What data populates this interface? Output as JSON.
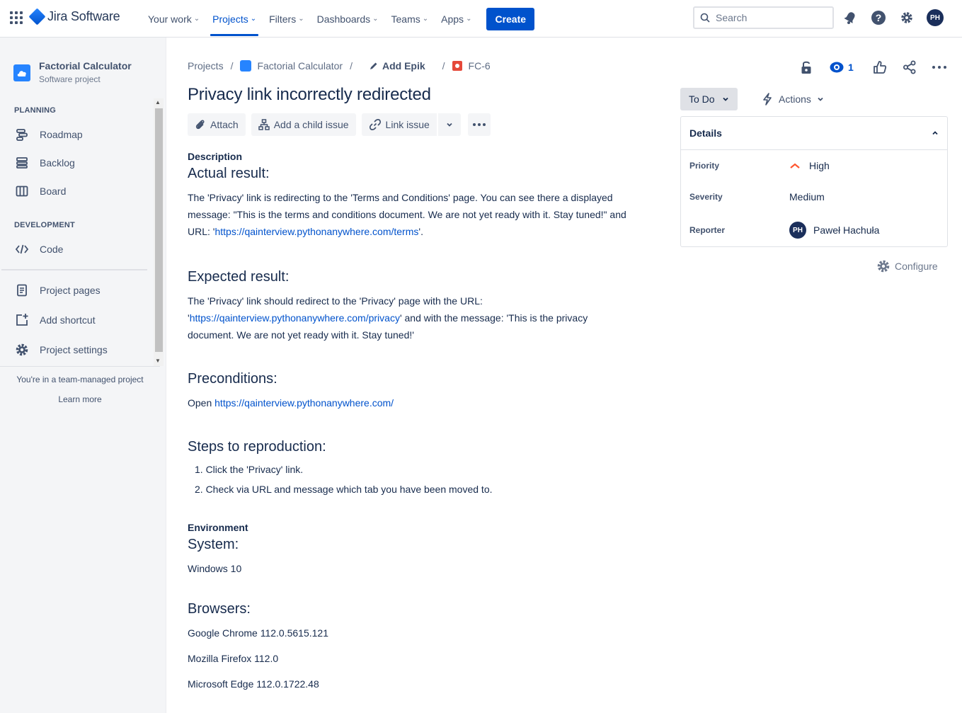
{
  "topnav": {
    "logo_text": "Jira Software",
    "items": [
      {
        "label": "Your work"
      },
      {
        "label": "Projects"
      },
      {
        "label": "Filters"
      },
      {
        "label": "Dashboards"
      },
      {
        "label": "Teams"
      },
      {
        "label": "Apps"
      }
    ],
    "create_label": "Create",
    "search_placeholder": "Search",
    "avatar_initials": "PH"
  },
  "sidebar": {
    "project_name": "Factorial Calculator",
    "project_type": "Software project",
    "planning_title": "PLANNING",
    "planning_items": [
      {
        "label": "Roadmap",
        "icon": "roadmap-icon"
      },
      {
        "label": "Backlog",
        "icon": "backlog-icon"
      },
      {
        "label": "Board",
        "icon": "board-icon"
      }
    ],
    "development_title": "DEVELOPMENT",
    "development_items": [
      {
        "label": "Code",
        "icon": "code-icon"
      }
    ],
    "other_items": [
      {
        "label": "Project pages",
        "icon": "pages-icon"
      },
      {
        "label": "Add shortcut",
        "icon": "add-shortcut-icon"
      },
      {
        "label": "Project settings",
        "icon": "gear-icon"
      }
    ],
    "team_note": "You're in a team-managed project",
    "learn_more": "Learn more"
  },
  "breadcrumb": {
    "projects": "Projects",
    "project": "Factorial Calculator",
    "add_epic": "Add Epik",
    "issue_key": "FC-6"
  },
  "issue": {
    "title": "Privacy link incorrectly redirected",
    "toolbar": {
      "attach": "Attach",
      "add_child": "Add a child issue",
      "link_issue": "Link issue"
    },
    "description_label": "Description",
    "actual_heading": "Actual result:",
    "actual_text_1": "The 'Privacy' link is redirecting to the 'Terms and Conditions' page. You can see there a displayed message: \"This is the terms and conditions document. We are not yet ready with it. Stay tuned!\" and URL: '",
    "actual_link": "https://qainterview.pythonanywhere.com/terms",
    "actual_text_2": "'.",
    "expected_heading": "Expected result:",
    "expected_text_1": "The 'Privacy' link should redirect to the 'Privacy' page with the URL: '",
    "expected_link": "https://qainterview.pythonanywhere.com/privacy",
    "expected_text_2": "' and with the message: 'This is the privacy document. We are not yet ready with it. Stay tuned!'",
    "preconditions_heading": "Preconditions:",
    "preconditions_prefix": "Open ",
    "preconditions_link": "https://qainterview.pythonanywhere.com/",
    "steps_heading": "Steps to reproduction:",
    "steps": [
      "1. Click the 'Privacy' link.",
      "2. Check via URL and message which tab you have been moved to."
    ],
    "environment_label": "Environment",
    "system_heading": "System:",
    "system_value": "Windows 10",
    "browsers_heading": "Browsers:",
    "browsers": [
      "Google Chrome 112.0.5615.121",
      "Mozilla Firefox 112.0",
      "Microsoft Edge 112.0.1722.48"
    ]
  },
  "right_panel": {
    "watch_count": "1",
    "status": "To Do",
    "actions": "Actions",
    "details_title": "Details",
    "priority_label": "Priority",
    "priority_value": "High",
    "severity_label": "Severity",
    "severity_value": "Medium",
    "reporter_label": "Reporter",
    "reporter_initials": "PH",
    "reporter_name": "Paweł Hachuła",
    "configure": "Configure",
    "priority_color": "#ff5630"
  }
}
